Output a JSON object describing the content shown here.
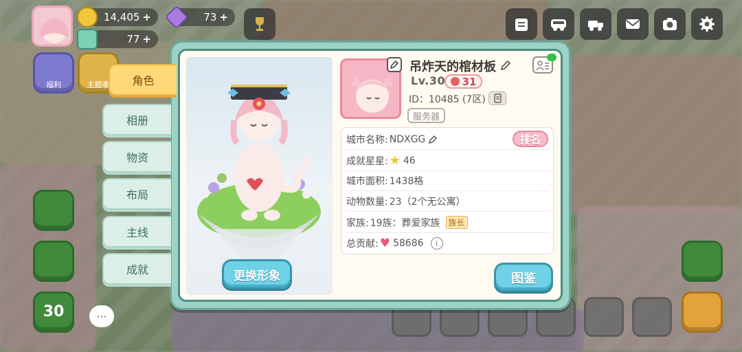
{
  "hud": {
    "coins": "14,405",
    "gems": "73",
    "tickets": "77",
    "plus": "+",
    "side_labels": [
      "福利",
      "主题季"
    ],
    "level_badge": "30",
    "icons": [
      "news-icon",
      "bus-icon",
      "truck-icon",
      "mail-icon",
      "camera-icon",
      "settings-gear-icon",
      "trophy-icon"
    ]
  },
  "tabs": [
    {
      "label": "角色",
      "active": true
    },
    {
      "label": "相册",
      "active": false
    },
    {
      "label": "物资",
      "active": false
    },
    {
      "label": "布局",
      "active": false
    },
    {
      "label": "主线",
      "active": false
    },
    {
      "label": "成就",
      "active": false
    }
  ],
  "portrait": {
    "change_button": "更换形象"
  },
  "profile": {
    "name": "吊炸天的棺材板",
    "level": "Lv.30",
    "badge_value": "31",
    "id_text": "ID：10485 (7区)",
    "server_button": "服务器"
  },
  "info": {
    "rank_button": "排名",
    "rows": [
      {
        "label": "城市名称:",
        "value": "NDXGG"
      },
      {
        "label": "成就星星:",
        "value": "46"
      },
      {
        "label": "城市面积:",
        "value": "1438格"
      },
      {
        "label": "动物数量:",
        "value": "23（2个无公寓）"
      },
      {
        "label": "家族:",
        "value": "19族：葬爱家族",
        "tag": "族长"
      },
      {
        "label": "总贡献:",
        "value": "58686"
      }
    ]
  },
  "atlas_button": "图鉴",
  "colors": {
    "dialog_frame": "#9ed2c6",
    "active_tab": "#ffd977",
    "primary_button": "#6fd0e6",
    "rank_button": "#f9bccb"
  }
}
